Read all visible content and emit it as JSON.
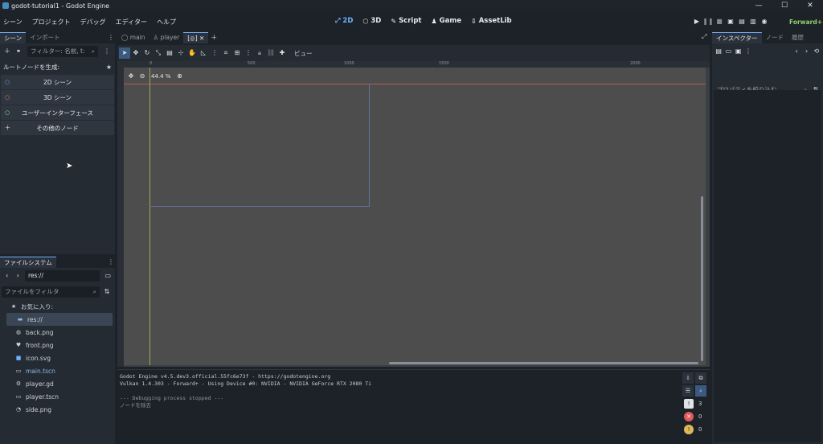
{
  "window": {
    "title": "godot-tutorial1 - Godot Engine",
    "minimize": "—",
    "maximize": "☐",
    "close": "✕"
  },
  "menu": [
    "シーン",
    "プロジェクト",
    "デバッグ",
    "エディター",
    "ヘルプ"
  ],
  "workspaces": [
    {
      "label": "2D",
      "icon": "2d-icon",
      "active": true
    },
    {
      "label": "3D",
      "icon": "3d-icon",
      "active": false
    },
    {
      "label": "Script",
      "icon": "script-icon",
      "active": false
    },
    {
      "label": "Game",
      "icon": "game-icon",
      "active": false
    },
    {
      "label": "AssetLib",
      "icon": "assetlib-icon",
      "active": false
    }
  ],
  "renderer": "Forward+",
  "scene_dock": {
    "tabs": [
      "シーン",
      "インポート"
    ],
    "filter_placeholder": "フィルター: 名前, t:",
    "create_root_label": "ルートノードを生成:",
    "root_buttons": [
      "2D シーン",
      "3D シーン",
      "ユーザーインターフェース",
      "その他のノード"
    ]
  },
  "filesystem": {
    "tab": "ファイルシステム",
    "path": "res://",
    "filter_placeholder": "ファイルをフィルタ",
    "favorites": "お気に入り:",
    "root": "res://",
    "files": [
      "back.png",
      "front.png",
      "icon.svg",
      "main.tscn",
      "player.gd",
      "player.tscn",
      "side.png"
    ]
  },
  "editor_tabs": [
    "main",
    "player"
  ],
  "toolbar": {
    "view_label": "ビュー"
  },
  "zoom": "44.4 %",
  "ruler_labels": [
    "0",
    "500",
    "1000",
    "1500",
    "2000"
  ],
  "output": {
    "lines": [
      "Godot Engine v4.5.dev3.official.55fc6e73f - https://godotengine.org",
      "Vulkan 1.4.303 - Forward+ - Using Device #0: NVIDIA - NVIDIA GeForce RTX 2080 Ti",
      "",
      "--- Debugging process stopped ---",
      "ノードを除去"
    ],
    "counts": [
      "3",
      "0",
      "0"
    ]
  },
  "inspector": {
    "tabs": [
      "インスペクター",
      "ノード",
      "履歴"
    ],
    "filter_placeholder": "プロパティを絞り込む"
  },
  "colors": {
    "accent": "#6cb2ff",
    "viewport": "#4d4d4d",
    "panel": "#252b33"
  }
}
